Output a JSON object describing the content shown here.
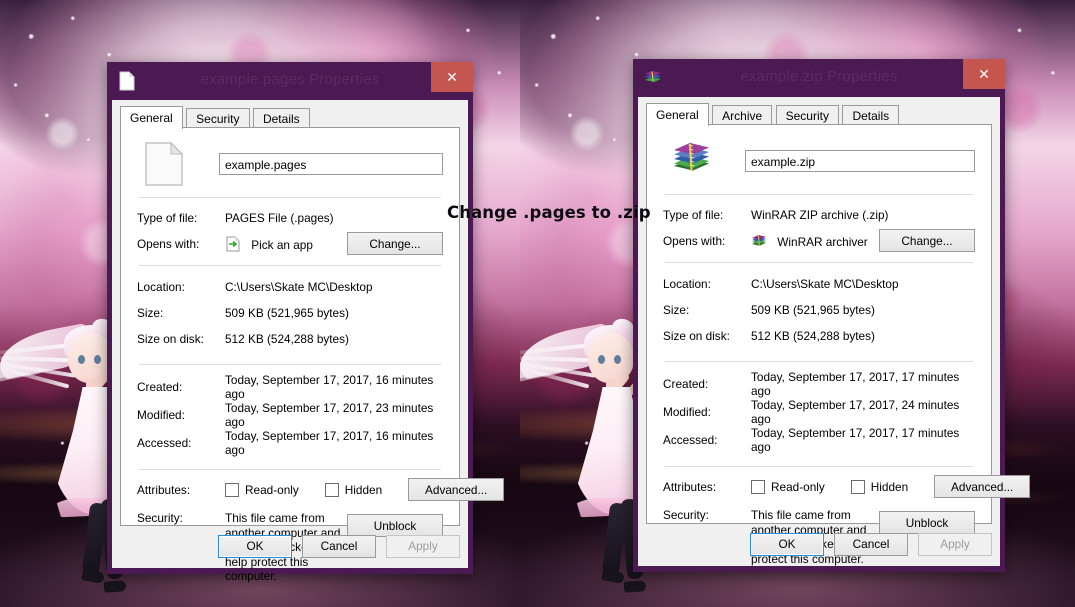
{
  "desktop": {
    "wallpaper_name": "anime-girl-pink-nebula-wallpaper",
    "annotation": "Change .pages to .zip",
    "accent_colors": {
      "titlebar_purple": "#4b1a52",
      "close_red": "#c4564f",
      "focus_blue": "#2a8fd8",
      "dialog_gray": "#f0f0f0"
    }
  },
  "left_dialog": {
    "title": "example.pages Properties",
    "title_icon": "generic-file-icon",
    "close_label": "✕",
    "tabs": [
      {
        "label": "General",
        "active": true
      },
      {
        "label": "Security",
        "active": false
      },
      {
        "label": "Details",
        "active": false
      }
    ],
    "file_icon": "generic-file-icon",
    "filename_value": "example.pages",
    "rows": [
      {
        "label": "Type of file:",
        "value": "PAGES File (.pages)"
      },
      {
        "label": "Opens with:",
        "value": "Pick an app",
        "icon": "pick-an-app-icon",
        "button": "Change..."
      },
      {
        "label": "Location:",
        "value": "C:\\Users\\Skate MC\\Desktop"
      },
      {
        "label": "Size:",
        "value": "509 KB (521,965 bytes)"
      },
      {
        "label": "Size on disk:",
        "value": "512 KB (524,288 bytes)"
      },
      {
        "label": "Created:",
        "value": "Today, September 17, 2017, 16 minutes ago"
      },
      {
        "label": "Modified:",
        "value": "Today, September 17, 2017, 23 minutes ago"
      },
      {
        "label": "Accessed:",
        "value": "Today, September 17, 2017, 16 minutes ago"
      }
    ],
    "attributes": {
      "label": "Attributes:",
      "readonly_label": "Read-only",
      "readonly_checked": false,
      "hidden_label": "Hidden",
      "hidden_checked": false,
      "advanced_button": "Advanced..."
    },
    "security": {
      "label": "Security:",
      "text": "This file came from another computer and might be blocked to help protect this computer.",
      "button": "Unblock"
    },
    "footer": {
      "ok": "OK",
      "cancel": "Cancel",
      "apply": "Apply",
      "apply_disabled": true
    }
  },
  "right_dialog": {
    "title": "example.zip Properties",
    "title_icon": "winrar-archive-icon",
    "close_label": "✕",
    "tabs": [
      {
        "label": "General",
        "active": true
      },
      {
        "label": "Archive",
        "active": false
      },
      {
        "label": "Security",
        "active": false
      },
      {
        "label": "Details",
        "active": false
      }
    ],
    "file_icon": "winrar-archive-icon",
    "filename_value": "example.zip",
    "rows": [
      {
        "label": "Type of file:",
        "value": "WinRAR ZIP archive (.zip)"
      },
      {
        "label": "Opens with:",
        "value": "WinRAR archiver",
        "icon": "winrar-archive-icon",
        "button": "Change..."
      },
      {
        "label": "Location:",
        "value": "C:\\Users\\Skate MC\\Desktop"
      },
      {
        "label": "Size:",
        "value": "509 KB (521,965 bytes)"
      },
      {
        "label": "Size on disk:",
        "value": "512 KB (524,288 bytes)"
      },
      {
        "label": "Created:",
        "value": "Today, September 17, 2017, 17 minutes ago"
      },
      {
        "label": "Modified:",
        "value": "Today, September 17, 2017, 24 minutes ago"
      },
      {
        "label": "Accessed:",
        "value": "Today, September 17, 2017, 17 minutes ago"
      }
    ],
    "attributes": {
      "label": "Attributes:",
      "readonly_label": "Read-only",
      "readonly_checked": false,
      "hidden_label": "Hidden",
      "hidden_checked": false,
      "advanced_button": "Advanced..."
    },
    "security": {
      "label": "Security:",
      "text": "This file came from another computer and might be blocked to help protect this computer.",
      "button": "Unblock"
    },
    "footer": {
      "ok": "OK",
      "cancel": "Cancel",
      "apply": "Apply",
      "apply_disabled": true
    }
  }
}
